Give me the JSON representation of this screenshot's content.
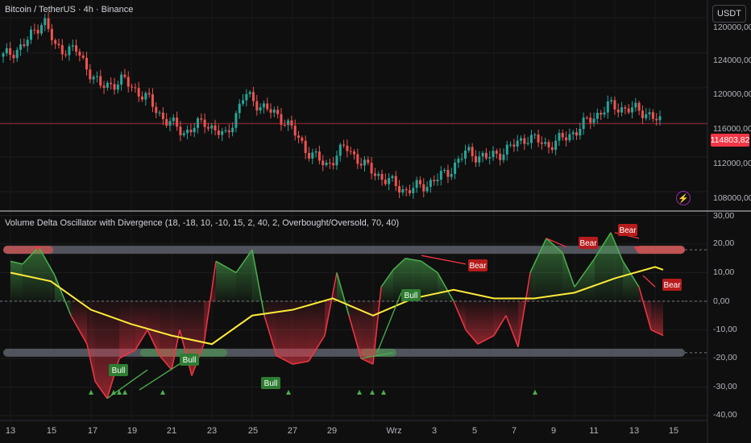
{
  "header": {
    "symbol_title": "Bitcoin / TetherUS · 4h · Binance",
    "currency_button": "USDT",
    "current_price": "114803,82"
  },
  "indicator": {
    "title": "Volume Delta Oscillator with Divergence (18, -18, 10, -10, 15, 2, 40, 2, Overbought/Oversold, 70, 40)"
  },
  "price_axis": {
    "ticks": [
      "120000,00",
      "124000,00",
      "120000,00",
      "116000,00",
      "112000,00",
      "108000,00"
    ]
  },
  "osc_axis": {
    "ticks": [
      "30,00",
      "20,00",
      "10,00",
      "0,00",
      "-10,00",
      "-20,00",
      "-30,00",
      "-40,00"
    ]
  },
  "time_axis": {
    "ticks": [
      "13",
      "15",
      "17",
      "19",
      "21",
      "23",
      "25",
      "27",
      "29",
      "Wrz",
      "3",
      "5",
      "7",
      "9",
      "11",
      "13",
      "15"
    ]
  },
  "divergence_labels": {
    "bull": [
      "Bull",
      "Bull",
      "Bull",
      "Bull"
    ],
    "bear": [
      "Bear",
      "Bear",
      "Bear",
      "Bear"
    ]
  },
  "colors": {
    "background": "#0f0f0f",
    "bull": "#26a69a",
    "bear": "#ef5350",
    "osc_green": "#4caf50",
    "osc_red": "#f23645",
    "signal": "#ffeb3b",
    "price_tag": "#f23645"
  },
  "icons": {
    "bolt": "lightning-bolt-icon"
  },
  "chart_data": [
    {
      "type": "candlestick",
      "title": "Bitcoin / TetherUS · 4h · Binance",
      "ylim": [
        106000,
        126000
      ],
      "x": [
        "13",
        "15",
        "17",
        "19",
        "21",
        "23",
        "25",
        "27",
        "29",
        "Wrz",
        "3",
        "5",
        "7",
        "9",
        "11",
        "13",
        "15"
      ],
      "close_path": [
        [
          0,
          121000
        ],
        [
          0.5,
          122000
        ],
        [
          1,
          124500
        ],
        [
          1.3,
          121800
        ],
        [
          1.8,
          121600
        ],
        [
          2.4,
          118200
        ],
        [
          3,
          118800
        ],
        [
          3.6,
          117000
        ],
        [
          4,
          115200
        ],
        [
          4.5,
          114000
        ],
        [
          5,
          115000
        ],
        [
          5.5,
          113500
        ],
        [
          6,
          117500
        ],
        [
          6.5,
          116200
        ],
        [
          7,
          115100
        ],
        [
          7.5,
          112500
        ],
        [
          8,
          110900
        ],
        [
          8.5,
          112700
        ],
        [
          9,
          110800
        ],
        [
          9.5,
          109600
        ],
        [
          10,
          108600
        ],
        [
          10.5,
          109200
        ],
        [
          11,
          110200
        ],
        [
          11.5,
          112200
        ],
        [
          12,
          111600
        ],
        [
          12.5,
          112400
        ],
        [
          13,
          113600
        ],
        [
          13.5,
          112800
        ],
        [
          14,
          113600
        ],
        [
          14.5,
          115000
        ],
        [
          15,
          116400
        ],
        [
          15.5,
          116200
        ],
        [
          16,
          115800
        ],
        [
          16.3,
          114900
        ]
      ],
      "current_price": 114803.82
    },
    {
      "type": "line",
      "title": "Volume Delta Oscillator with Divergence",
      "ylim": [
        -40,
        30
      ],
      "series": [
        {
          "name": "",
          "role": "oscillator",
          "points": [
            [
              0,
              14
            ],
            [
              0.3,
              13
            ],
            [
              0.7,
              19
            ],
            [
              1.1,
              9
            ],
            [
              1.5,
              -5
            ],
            [
              1.9,
              -15
            ],
            [
              2.1,
              -28
            ],
            [
              2.4,
              -34
            ],
            [
              2.7,
              -20
            ],
            [
              3.1,
              -17
            ],
            [
              3.4,
              -10
            ],
            [
              3.7,
              -19
            ],
            [
              4,
              -24
            ],
            [
              4.2,
              -10
            ],
            [
              4.5,
              -26
            ],
            [
              4.8,
              -15
            ],
            [
              5.1,
              14
            ],
            [
              5.6,
              10
            ],
            [
              6,
              18
            ],
            [
              6.3,
              -5
            ],
            [
              6.6,
              -19
            ],
            [
              7,
              -22
            ],
            [
              7.4,
              -21
            ],
            [
              7.8,
              -12
            ],
            [
              8.1,
              10
            ],
            [
              8.4,
              -5
            ],
            [
              8.7,
              -20
            ],
            [
              9,
              -22
            ],
            [
              9.2,
              5
            ],
            [
              9.5,
              11
            ],
            [
              9.8,
              15
            ],
            [
              10.2,
              14
            ],
            [
              10.6,
              10
            ],
            [
              11,
              0
            ],
            [
              11.3,
              -10
            ],
            [
              11.6,
              -15
            ],
            [
              12,
              -12
            ],
            [
              12.3,
              -5
            ],
            [
              12.6,
              -16
            ],
            [
              12.9,
              10
            ],
            [
              13.3,
              22
            ],
            [
              13.7,
              17
            ],
            [
              14,
              5
            ],
            [
              14.5,
              15
            ],
            [
              14.9,
              24
            ],
            [
              15.2,
              14
            ],
            [
              15.6,
              5
            ],
            [
              15.9,
              -10
            ],
            [
              16.2,
              -12
            ]
          ]
        },
        {
          "name": "",
          "role": "signal",
          "points": [
            [
              0,
              10
            ],
            [
              1,
              7
            ],
            [
              2,
              -3
            ],
            [
              3,
              -8
            ],
            [
              4,
              -12
            ],
            [
              5,
              -15
            ],
            [
              6,
              -5
            ],
            [
              7,
              -3
            ],
            [
              8,
              1
            ],
            [
              9,
              -5
            ],
            [
              10,
              1
            ],
            [
              11,
              4
            ],
            [
              12,
              1
            ],
            [
              13,
              1
            ],
            [
              14,
              3
            ],
            [
              15,
              8
            ],
            [
              16,
              12
            ],
            [
              16.2,
              11
            ]
          ]
        }
      ],
      "levels": [
        18,
        10,
        0,
        -10,
        -18
      ]
    }
  ]
}
